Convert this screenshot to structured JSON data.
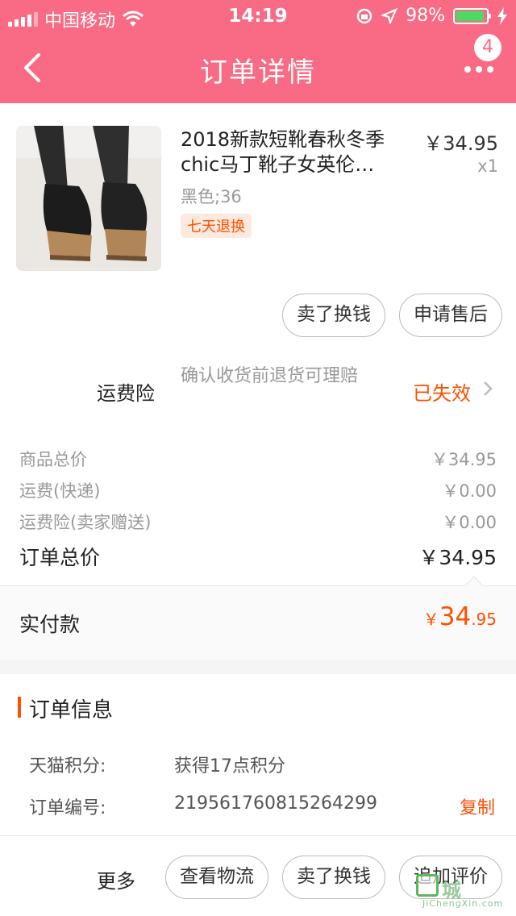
{
  "status_bar": {
    "carrier": "中国移动",
    "time": "14:19",
    "battery": "98%",
    "battery_level": 0.98,
    "icons": [
      "signal-icon",
      "wifi-icon",
      "rotation-lock-icon",
      "location-icon",
      "battery-icon",
      "charging-icon"
    ]
  },
  "nav": {
    "title": "订单详情",
    "badge_count": "4",
    "icons": [
      "back-icon",
      "more-icon"
    ]
  },
  "product": {
    "name": "2018新款短靴春秋冬季chic马丁靴子女英伦…",
    "price": "￥34.95",
    "quantity": "x1",
    "sku": "黑色;36",
    "tag": "七天退换",
    "buttons": [
      "卖了换钱",
      "申请售后"
    ]
  },
  "insurance": {
    "label": "运费险",
    "description": "确认收货前退货可理赔",
    "status": "已失效"
  },
  "summary": {
    "rows": [
      {
        "label": "商品总价",
        "value": "￥34.95"
      },
      {
        "label": "运费(快递)",
        "value": "￥0.00"
      },
      {
        "label": "运费险(卖家赠送)",
        "value": "￥0.00"
      }
    ],
    "total_label": "订单总价",
    "total_value": "￥34.95"
  },
  "payment": {
    "label": "实付款",
    "currency": "￥",
    "integer": "34",
    "decimal": ".95"
  },
  "order_info": {
    "heading": "订单信息",
    "points_label": "天猫积分:",
    "points_value": "获得17点积分",
    "order_no_label": "订单编号:",
    "order_no_value": "2195617608152642​99",
    "copy_label": "复制"
  },
  "actions": {
    "more_label": "更多",
    "buttons": [
      "查看物流",
      "卖了换钱",
      "追加评价"
    ]
  },
  "watermark": {
    "text": "城",
    "sub": "JiChengXin.com"
  },
  "colors": {
    "header": "#f96b84",
    "accent": "#ff5000"
  }
}
